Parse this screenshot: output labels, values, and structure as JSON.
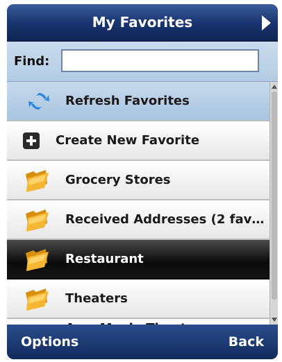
{
  "header": {
    "title": "My Favorites"
  },
  "find": {
    "label": "Find:",
    "value": ""
  },
  "list": {
    "items": [
      {
        "label": "Refresh Favorites"
      },
      {
        "label": "Create New Favorite"
      },
      {
        "label": "Grocery Stores"
      },
      {
        "label": "Received Addresses (2 favor..."
      },
      {
        "label": "Restaurant"
      },
      {
        "label": "Theaters"
      },
      {
        "label": "Amc Movie Theatre"
      }
    ]
  },
  "softkeys": {
    "left": "Options",
    "right": "Back"
  },
  "colors": {
    "titlebar": "#1a3570",
    "selected": "#b3cbe3",
    "highlight": "#0a0a0a"
  }
}
